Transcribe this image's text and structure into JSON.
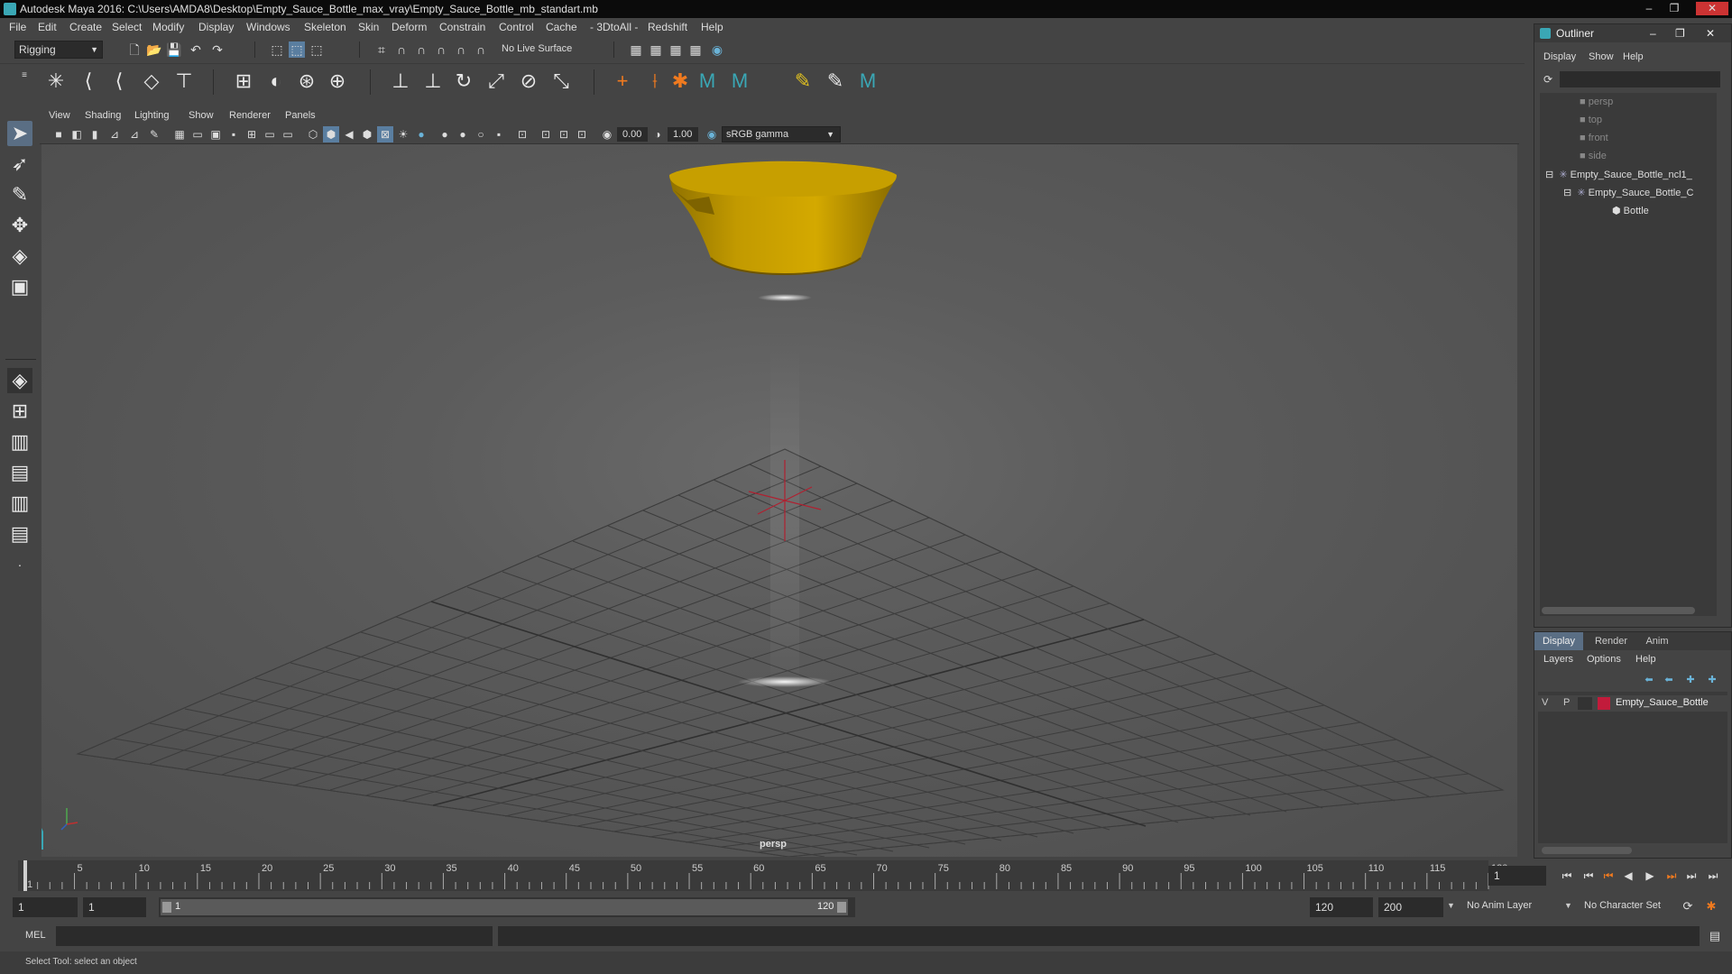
{
  "window": {
    "title": "Autodesk Maya 2016: C:\\Users\\AMDA8\\Desktop\\Empty_Sauce_Bottle_max_vray\\Empty_Sauce_Bottle_mb_standart.mb",
    "min": "–",
    "max": "❐",
    "close": "✕"
  },
  "menubar": [
    "File",
    "Edit",
    "Create",
    "Select",
    "Modify",
    "Display",
    "Windows",
    "Skeleton",
    "Skin",
    "Deform",
    "Constrain",
    "Control",
    "Cache",
    "- 3DtoAll -",
    "Redshift",
    "Help"
  ],
  "shelf": {
    "mode": "Rigging",
    "live_surface": "No Live Surface"
  },
  "viewport": {
    "menus": [
      "View",
      "Shading",
      "Lighting",
      "Show",
      "Renderer",
      "Panels"
    ],
    "exposure": "0.00",
    "gamma": "1.00",
    "color_space": "sRGB gamma",
    "camera_label": "persp"
  },
  "outliner": {
    "title": "Outliner",
    "menus": [
      "Display",
      "Show",
      "Help"
    ],
    "items": [
      "persp",
      "top",
      "front",
      "side",
      "Empty_Sauce_Bottle_ncl1_",
      "Empty_Sauce_Bottle_C",
      "Bottle"
    ]
  },
  "layers": {
    "tabs": [
      "Display",
      "Render",
      "Anim"
    ],
    "menus": [
      "Layers",
      "Options",
      "Help"
    ],
    "row": {
      "v": "V",
      "p": "P",
      "name": "Empty_Sauce_Bottle",
      "color": "#c21b3b"
    }
  },
  "timeline": {
    "ticks": [
      "1",
      "5",
      "10",
      "15",
      "20",
      "25",
      "30",
      "35",
      "40",
      "45",
      "50",
      "55",
      "60",
      "65",
      "70",
      "75",
      "80",
      "85",
      "90",
      "95",
      "100",
      "105",
      "110",
      "115",
      "120"
    ],
    "current_frame": "1"
  },
  "range": {
    "start": "1",
    "playback_start": "1",
    "slider_start": "1",
    "slider_end": "120",
    "playback_end": "120",
    "end": "200",
    "anim_layer": "No Anim Layer",
    "char_set": "No Character Set"
  },
  "cmd": {
    "label": "MEL"
  },
  "help_line": "Select Tool: select an object",
  "colors": {
    "object": "#c9a100",
    "accent": "#3aa7b5"
  }
}
